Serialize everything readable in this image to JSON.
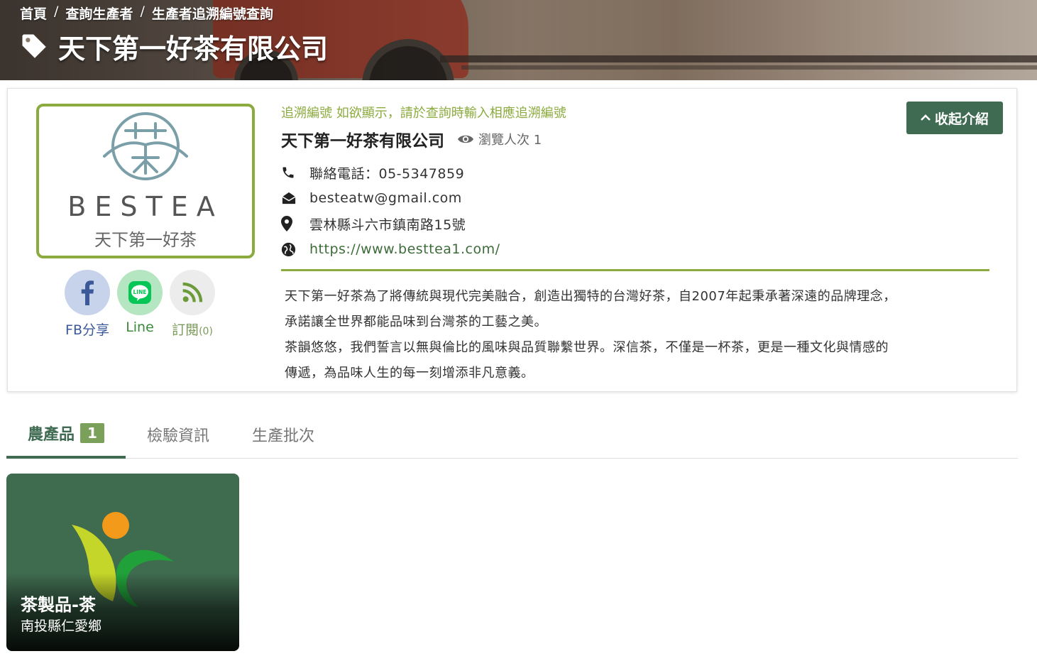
{
  "breadcrumb": {
    "home": "首頁",
    "sep": "/",
    "query": "查詢生產者",
    "current": "生產者追溯編號查詢"
  },
  "hero": {
    "title": "天下第一好茶有限公司"
  },
  "logo": {
    "brand": "BESTEA",
    "sub": "天下第一好茶"
  },
  "social": {
    "fb_label": "FB分享",
    "line_label": "Line",
    "line_icon_text": "LINE",
    "subscribe_label": "訂閱",
    "subscribe_count": "(0)"
  },
  "profile": {
    "trace_note": "追溯編號 如欲顯示，請於查詢時輸入相應追溯編號",
    "company": "天下第一好茶有限公司",
    "views": "瀏覽人次 1",
    "phone": "聯絡電話：05-5347859",
    "email": "besteatw@gmail.com",
    "address": "雲林縣斗六市鎮南路15號",
    "website": "https://www.besttea1.com/",
    "description": [
      "天下第一好茶為了將傳統與現代完美融合，創造出獨特的台灣好茶，自2007年起秉承著深遠的品牌理念，",
      "承諾讓全世界都能品味到台灣茶的工藝之美。",
      "茶韻悠悠，我們誓言以無與倫比的風味與品質聯繫世界。深信茶，不僅是一杯茶，更是一種文化與情感的",
      "傳遞，為品味人生的每一刻增添非凡意義。"
    ],
    "collapse_label": "收起介紹"
  },
  "tabs": [
    {
      "label": "農產品",
      "badge": "1"
    },
    {
      "label": "檢驗資訊"
    },
    {
      "label": "生產批次"
    }
  ],
  "products": [
    {
      "title": "茶製品-茶",
      "location": "南投縣仁愛鄉"
    }
  ],
  "colors": {
    "accent_green": "#8cab3f",
    "dark_green": "#3e6b52",
    "badge_green": "#7aa05a",
    "fb_blue": "#3b5998",
    "line_green": "#06c755"
  }
}
